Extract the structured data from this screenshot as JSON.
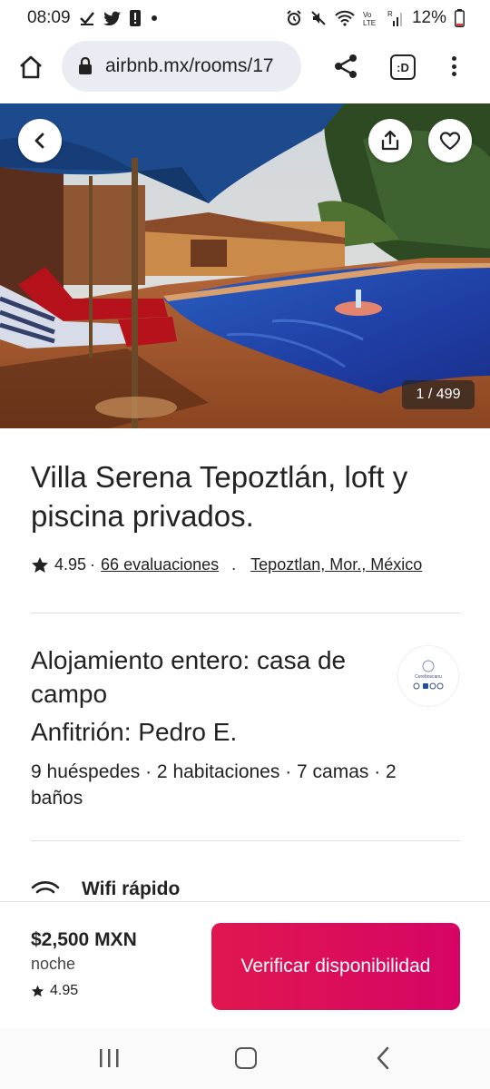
{
  "status_bar": {
    "time": "08:09",
    "battery": "12%"
  },
  "browser": {
    "url": "airbnb.mx/rooms/17",
    "tabs_label": ":D"
  },
  "gallery": {
    "counter": "1 / 499"
  },
  "listing": {
    "title": "Villa Serena Tepoztlán, loft y piscina privados.",
    "rating": "4.95",
    "dot": "·",
    "reviews": "66 evaluaciones",
    "separator": ".",
    "location": "Tepoztlan, Mor., México",
    "home_type": "Alojamiento entero: casa de campo",
    "host": "Anfitrión: Pedro E.",
    "capacity": "9 huéspedes · 2 habitaciones · 7 camas · 2 baños",
    "host_avatar_text": "Cereboscanu"
  },
  "amenities": [
    {
      "label": "Wifi rápido",
      "icon": "wifi-icon"
    }
  ],
  "booking": {
    "price": "$2,500 MXN",
    "per": "noche",
    "rating": "4.95",
    "cta": "Verificar disponibilidad",
    "accent": "#e31c5f"
  }
}
